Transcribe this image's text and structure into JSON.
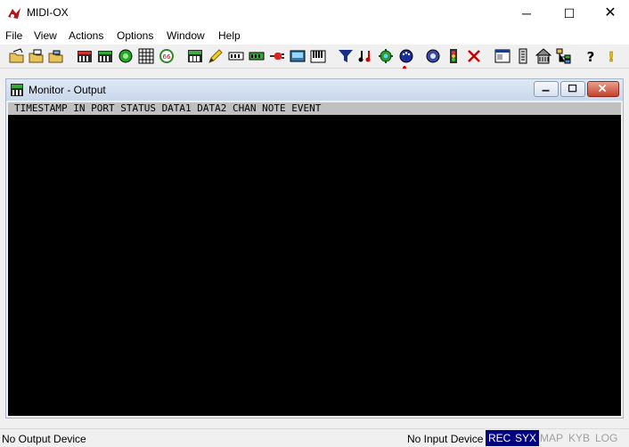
{
  "window": {
    "title": "MIDI-OX",
    "minimize": "─",
    "maximize": "☐",
    "close": "✕"
  },
  "menu": [
    "File",
    "View",
    "Actions",
    "Options",
    "Window",
    "Help"
  ],
  "toolbar": {
    "icons": [
      "open-icon",
      "open-folder-icon",
      "save-icon",
      "keyboard-icon",
      "port-routing-icon",
      "record-icon",
      "grid-icon",
      "midi-map-icon",
      "piano-icon",
      "pencil-icon",
      "sysex-icon",
      "instrument-icon",
      "midi-cable-icon",
      "display-icon",
      "midi-keys-icon",
      "filter-icon",
      "notes-icon",
      "gear-network-icon",
      "midi-port-icon",
      "midi-devices-icon",
      "traffic-light-icon",
      "delete-icon",
      "window-icon",
      "panel-icon",
      "house-icon",
      "tree-icon",
      "help-icon",
      "exclamation-icon"
    ]
  },
  "child_window": {
    "title": "Monitor - Output",
    "header": "TIMESTAMP IN PORT STATUS DATA1 DATA2 CHAN NOTE EVENT"
  },
  "status": {
    "output_device": "No Output Device",
    "input_device": "No Input Device",
    "indicators": [
      {
        "label": "REC",
        "active": true
      },
      {
        "label": "SYX",
        "active": true
      },
      {
        "label": "MAP",
        "active": false
      },
      {
        "label": "KYB",
        "active": false
      },
      {
        "label": "LOG",
        "active": false
      }
    ]
  },
  "colors": {
    "monitor_bg": "#000000",
    "indicator_active": "#000080",
    "annotation_arrow": "#e00000"
  }
}
